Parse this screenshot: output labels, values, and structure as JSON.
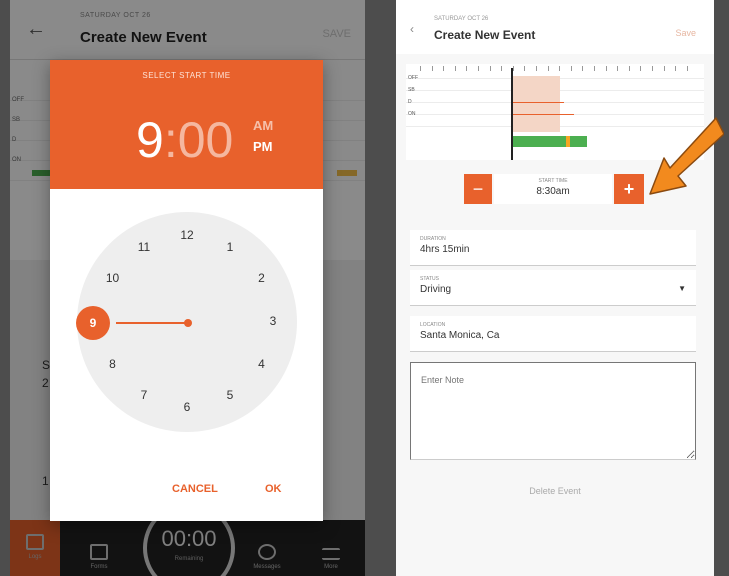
{
  "left_app": {
    "subtitle": "SATURDAY OCT 26",
    "title": "Create New Event",
    "save_label": "SAVE",
    "graph_labels": [
      "OFF",
      "SB",
      "D",
      "ON"
    ],
    "lower_rows": [
      "S",
      "2",
      "",
      "1"
    ],
    "nav": {
      "logs": "Logs",
      "forms": "Forms",
      "timer": "00:00",
      "timer_sub": "Remaining",
      "messages": "Messages",
      "more": "More"
    }
  },
  "time_picker": {
    "label": "SELECT START TIME",
    "hour": "9",
    "separator": ":",
    "minutes": "00",
    "am": "AM",
    "pm": "PM",
    "clock_numbers": [
      "12",
      "1",
      "2",
      "3",
      "4",
      "5",
      "6",
      "7",
      "8",
      "9",
      "10",
      "11"
    ],
    "selected": "9",
    "cancel": "CANCEL",
    "ok": "OK"
  },
  "right_app": {
    "subtitle": "SATURDAY OCT 26",
    "title": "Create New Event",
    "save_label": "Save",
    "graph_labels": [
      "OFF",
      "SB",
      "D",
      "ON"
    ],
    "start_time": {
      "label": "START TIME",
      "value": "8:30am",
      "minus": "−",
      "plus": "+"
    },
    "duration": {
      "label": "DURATION",
      "value": "4hrs 15min"
    },
    "status": {
      "label": "STATUS",
      "value": "Driving"
    },
    "location": {
      "label": "LOCATION",
      "value": "Santa Monica, Ca"
    },
    "note_placeholder": "Enter Note",
    "delete_label": "Delete Event"
  },
  "colors": {
    "accent": "#e8612c",
    "green": "#4caf50",
    "arrow": "#f28a1e"
  },
  "icons": [
    "back-arrow-icon",
    "logs-icon",
    "forms-icon",
    "messages-icon",
    "menu-icon",
    "dropdown-caret-icon",
    "pointer-arrow-icon"
  ]
}
